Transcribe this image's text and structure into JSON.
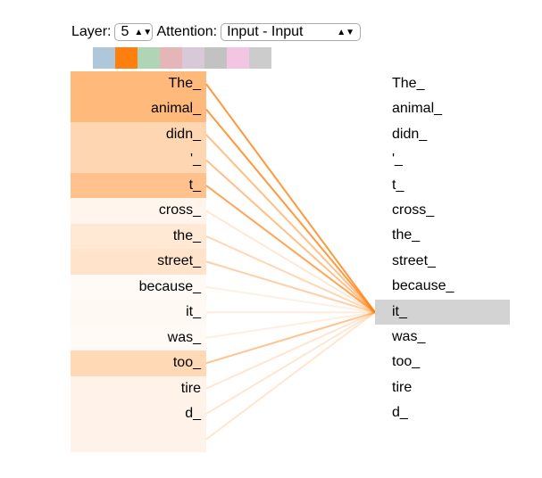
{
  "controls": {
    "layer_label": "Layer:",
    "layer_value": "5",
    "attention_label": "Attention:",
    "attention_value": "Input - Input"
  },
  "head_colors": [
    "#aec7da",
    "#ff7f0e",
    "#afd5b5",
    "#e6b5b7",
    "#d8c9d9",
    "#c2c2c2",
    "#f2c6e2",
    "#cccccc"
  ],
  "selected_head": 1,
  "accent": "#ff7f0e",
  "left_tokens": [
    "The_",
    "animal_",
    "didn_",
    "'_",
    "t_",
    "cross_",
    "the_",
    "street_",
    "because_",
    "it_",
    "was_",
    "too_",
    "tire",
    "d_",
    ""
  ],
  "attention_weights": [
    0.55,
    0.55,
    0.32,
    0.32,
    0.48,
    0.08,
    0.18,
    0.22,
    0.03,
    0.05,
    0.04,
    0.3,
    0.09,
    0.09,
    0.09
  ],
  "right_tokens": [
    "The_",
    "animal_",
    "didn_",
    "'_",
    "t_",
    "cross_",
    "the_",
    "street_",
    "because_",
    "it_",
    "was_",
    "too_",
    "tire",
    "d_"
  ],
  "selected_right_index": 9
}
